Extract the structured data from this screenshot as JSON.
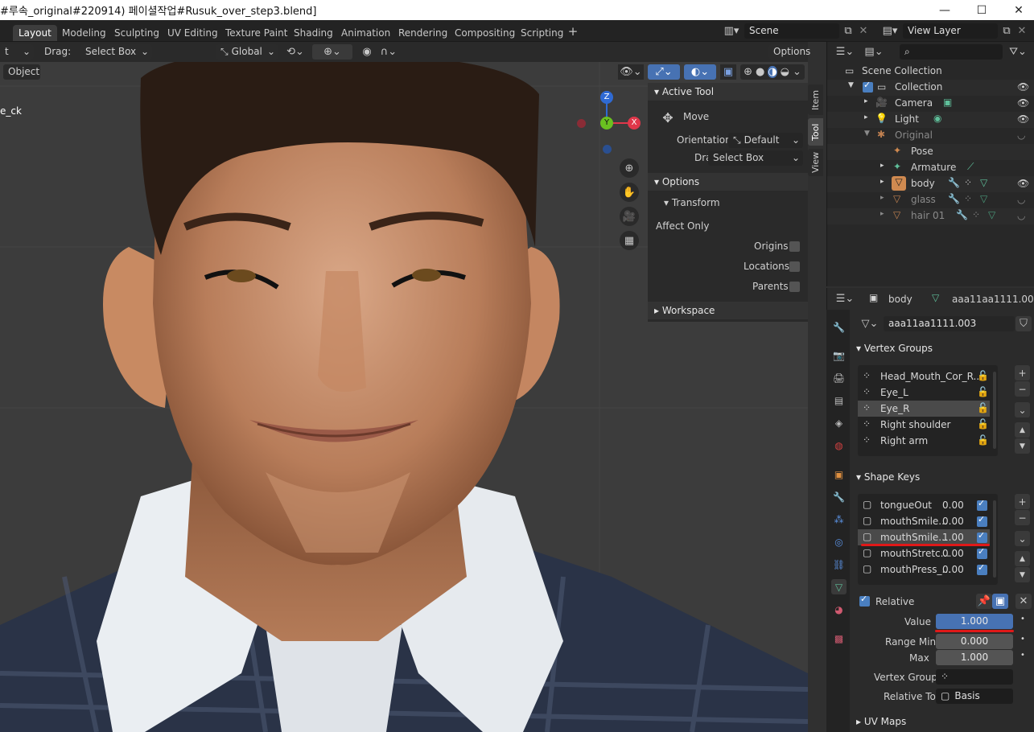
{
  "window": {
    "title": "#루속_original#220914) 페이셜작업#Rusuk_over_step3.blend]"
  },
  "workspaces": [
    {
      "label": "Layout",
      "active": true
    },
    {
      "label": "Modeling"
    },
    {
      "label": "Sculpting"
    },
    {
      "label": "UV Editing"
    },
    {
      "label": "Texture Paint"
    },
    {
      "label": "Shading"
    },
    {
      "label": "Animation"
    },
    {
      "label": "Rendering"
    },
    {
      "label": "Compositing"
    },
    {
      "label": "Scripting"
    }
  ],
  "scene": {
    "name": "Scene",
    "view_layer": "View Layer"
  },
  "viewport_header": {
    "mode_fragment": "t",
    "drag_label": "Drag:",
    "drag_value": "Select Box",
    "orientation": "Global",
    "options_label": "Options",
    "object_menu": "Object",
    "overlay_text": "e_ck"
  },
  "gizmo": {
    "z": "Z",
    "y": "Y",
    "x": "X"
  },
  "npanel": {
    "tabs": [
      "Item",
      "Tool",
      "View"
    ],
    "active_tool_title": "Active Tool",
    "tool_name": "Move",
    "orientation_label": "Orientation",
    "orientation_value": "Default",
    "drag_label": "Drag:",
    "drag_value": "Select Box",
    "options_title": "Options",
    "transform_title": "Transform",
    "affect_only": "Affect Only",
    "origins": "Origins",
    "locations": "Locations",
    "parents": "Parents",
    "workspace_title": "Workspace"
  },
  "outliner": {
    "scene_collection": "Scene Collection",
    "items": [
      {
        "label": "Collection",
        "depth": 1
      },
      {
        "label": "Camera",
        "depth": 2
      },
      {
        "label": "Light",
        "depth": 2
      },
      {
        "label": "Original",
        "depth": 2,
        "dim": true
      },
      {
        "label": "Pose",
        "depth": 3
      },
      {
        "label": "Armature",
        "depth": 3
      },
      {
        "label": "body",
        "depth": 3
      },
      {
        "label": "glass",
        "depth": 3,
        "dim": true
      },
      {
        "label": "hair 01",
        "depth": 3,
        "dim": true
      }
    ]
  },
  "properties": {
    "object_name": "body",
    "mesh_name": "aaa11aa1111.003",
    "data_field": "aaa11aa1111.003",
    "vertex_groups_title": "Vertex Groups",
    "vertex_groups": [
      "Head_Mouth_Cor_R...",
      "Eye_L",
      "Eye_R",
      "Right shoulder",
      "Right arm"
    ],
    "selected_vertex_group": "Eye_R",
    "shape_keys_title": "Shape Keys",
    "shape_keys": [
      {
        "name": "tongueOut",
        "value": "0.00"
      },
      {
        "name": "mouthSmile...",
        "value": "0.00"
      },
      {
        "name": "mouthSmile...",
        "value": "1.00",
        "selected": true
      },
      {
        "name": "mouthStretc...",
        "value": "0.00"
      },
      {
        "name": "mouthPress_...",
        "value": "0.00"
      }
    ],
    "relative_label": "Relative",
    "value_label": "Value",
    "value": "1.000",
    "range_min_label": "Range Min",
    "range_min": "0.000",
    "max_label": "Max",
    "max": "1.000",
    "vertex_group_label": "Vertex Group",
    "relative_to_label": "Relative To",
    "relative_to": "Basis",
    "uv_maps_title": "UV Maps"
  },
  "colors": {
    "accent": "#4772b3",
    "highlight_line": "#e01818"
  }
}
